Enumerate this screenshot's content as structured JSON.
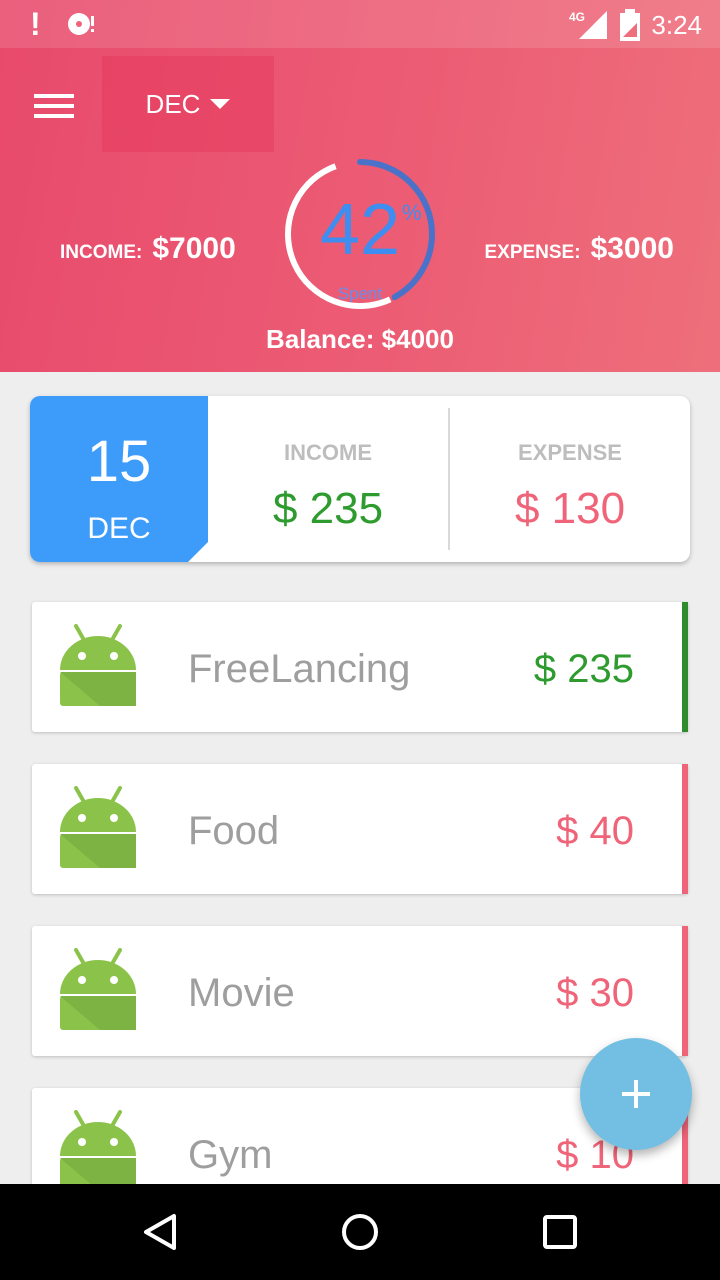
{
  "status_bar": {
    "time": "3:24",
    "network": "4G"
  },
  "header": {
    "month": "DEC",
    "income_label": "INCOME:",
    "income_value": "$7000",
    "expense_label": "EXPENSE:",
    "expense_value": "$3000",
    "spent_percent_text": "42",
    "spent_percent_sign": "%",
    "spent_label": "Spent",
    "spent_fraction": 0.42,
    "balance": "Balance: $4000"
  },
  "day_card": {
    "day": "15",
    "month": "DEC",
    "income_label": "INCOME",
    "income_value": "$ 235",
    "expense_label": "EXPENSE",
    "expense_value": "$ 130"
  },
  "transactions": [
    {
      "name": "FreeLancing",
      "amount": "$ 235",
      "color": "#2e9b2e",
      "stripe": "#2e8b2e",
      "type": "income"
    },
    {
      "name": "Food",
      "amount": "$ 40",
      "color": "#ef6478",
      "stripe": "#ef6478",
      "type": "expense"
    },
    {
      "name": "Movie",
      "amount": "$ 30",
      "color": "#ef6478",
      "stripe": "#ef6478",
      "type": "expense"
    },
    {
      "name": "Gym",
      "amount": "$ 10",
      "color": "#ef6478",
      "stripe": "#ef6478",
      "type": "expense"
    }
  ],
  "colors": {
    "header": "#e84a6c",
    "date_box": "#3d9bfa",
    "fab": "#72bfe3",
    "gauge_arc": "#4a72c9"
  },
  "icons": {
    "menu": "hamburger-menu-icon",
    "category": "android-robot-icon",
    "fab": "plus-icon"
  }
}
